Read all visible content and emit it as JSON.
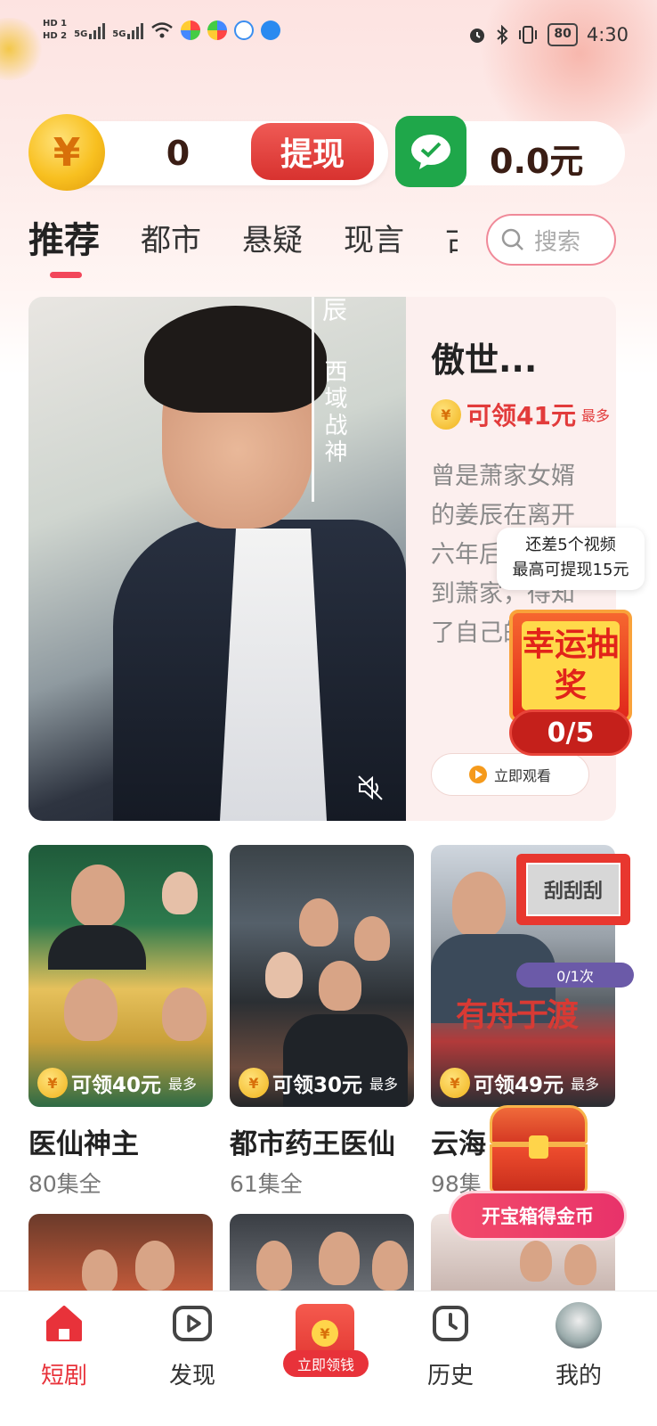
{
  "status_bar": {
    "hd1": "HD 1",
    "hd2": "HD 2",
    "sig1": "5G",
    "sig2": "5G",
    "battery": "80",
    "time": "4:30"
  },
  "wallet": {
    "coins": "0",
    "withdraw_label": "提现",
    "cash": "0.0元",
    "coin_symbol": "¥"
  },
  "tabs": [
    "推荐",
    "都市",
    "悬疑",
    "现言",
    "古"
  ],
  "search": {
    "placeholder": "搜索"
  },
  "featured": {
    "poster_text_top": "辰",
    "poster_text": "西域战神",
    "title": "傲世...",
    "reward": "可领41元",
    "reward_suffix": "最多",
    "description": "曾是萧家女婿的姜辰在离开六年后终于回到萧家，得知了自己的",
    "watch_label": "立即观看"
  },
  "lottery_tip": {
    "line1": "还差5个视频",
    "line2": "最高可提现15元"
  },
  "lottery": {
    "label": "幸运抽奖",
    "count": "0/5"
  },
  "dramas": [
    {
      "title": "医仙神主",
      "episodes": "80集全",
      "reward": "可领40元",
      "suffix": "最多"
    },
    {
      "title": "都市药王医仙",
      "episodes": "61集全",
      "reward": "可领30元",
      "suffix": "最多"
    },
    {
      "title": "云海",
      "episodes": "98集",
      "reward": "可领49元",
      "suffix": "最多",
      "poster_text": "有舟于渡"
    }
  ],
  "scratch": {
    "label": "刮刮刮",
    "count": "0/1次"
  },
  "treasure": {
    "label": "开宝箱得金币"
  },
  "bottom_nav": {
    "short_drama": "短剧",
    "discover": "发现",
    "center": "立即领钱",
    "history": "历史",
    "mine": "我的"
  },
  "colors": {
    "accent": "#e8323a",
    "tab_indicator": "#f2465a",
    "reward_text": "#e23b3b"
  }
}
